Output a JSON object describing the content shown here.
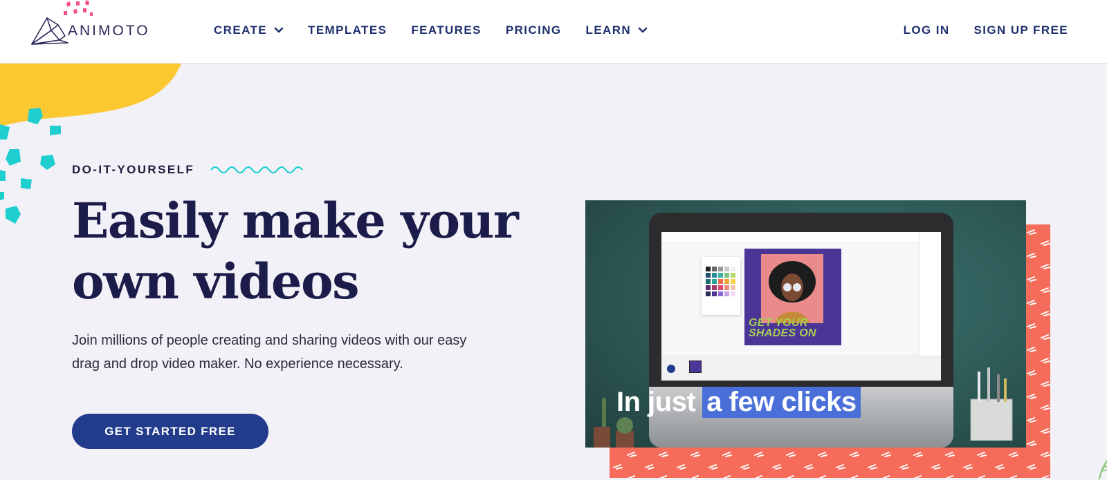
{
  "header": {
    "logo_text": "ANIMOTO",
    "nav": [
      {
        "label": "CREATE",
        "dropdown": true
      },
      {
        "label": "TEMPLATES",
        "dropdown": false
      },
      {
        "label": "FEATURES",
        "dropdown": false
      },
      {
        "label": "PRICING",
        "dropdown": false
      },
      {
        "label": "LEARN",
        "dropdown": true
      }
    ],
    "login_label": "LOG IN",
    "signup_label": "SIGN UP FREE"
  },
  "hero": {
    "eyebrow": "DO-IT-YOURSELF",
    "headline_line1": "Easily make your",
    "headline_line2": "own videos",
    "subcopy_line1": "Join millions of people creating and sharing videos with our easy",
    "subcopy_line2": "drag and drop video maker. No experience necessary.",
    "cta_label": "GET STARTED FREE"
  },
  "video": {
    "caption_plain": "In just",
    "caption_highlight": "a few clicks",
    "preview_title_line1": "GET YOUR",
    "preview_title_line2": "SHADES ON"
  },
  "colors": {
    "nav_text": "#1f2f6e",
    "cta_bg": "#223c8b",
    "page_bg": "#f2f1f7",
    "accent_yellow": "#fcc832",
    "accent_teal": "#1fcfcf",
    "accent_coral": "#f56d5a",
    "caption_highlight": "#4b6fd8"
  },
  "icons": [
    "animoto-logo-icon",
    "chevron-down-icon",
    "wavy-line-icon",
    "play-icon"
  ]
}
